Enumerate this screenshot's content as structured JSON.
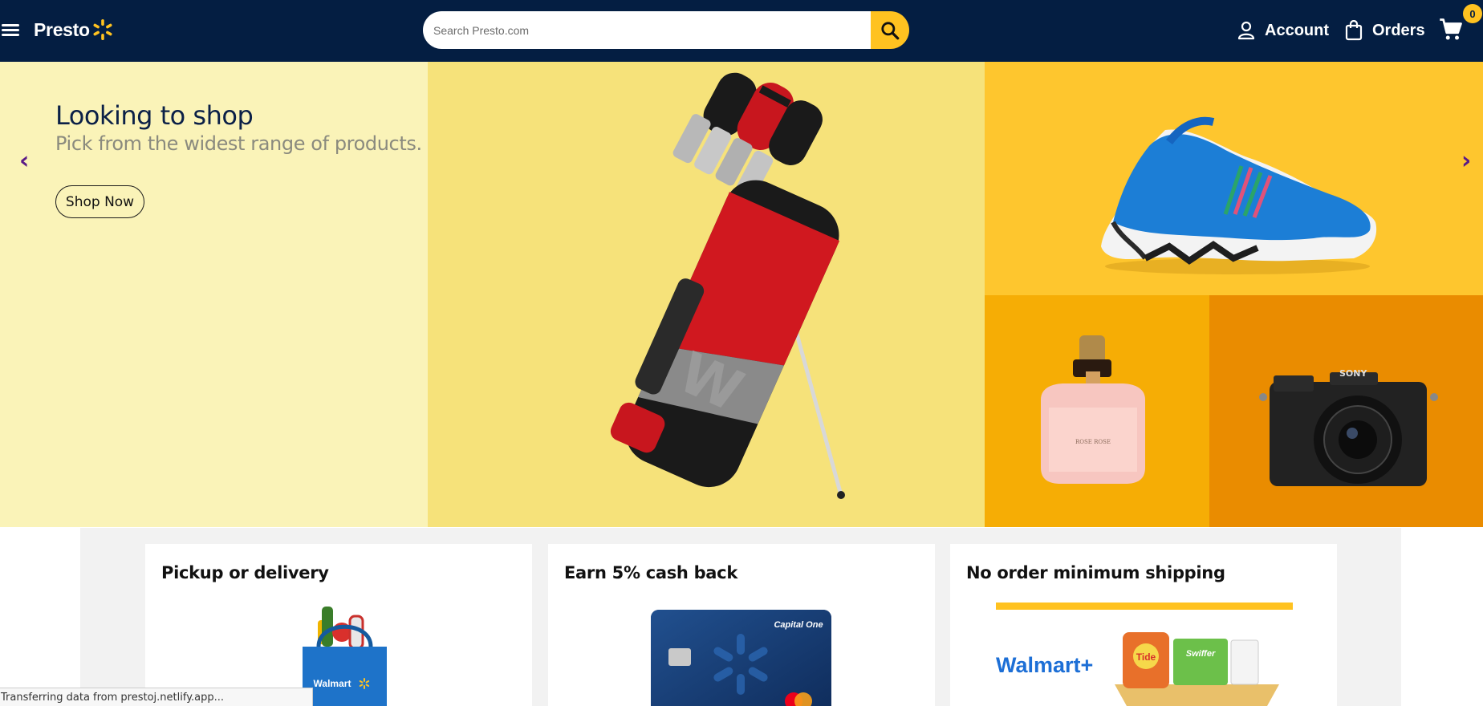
{
  "header": {
    "logo_text": "Presto",
    "search_placeholder": "Search Presto.com",
    "account_label": "Account",
    "orders_label": "Orders",
    "cart_count": "0",
    "colors": {
      "bg": "#041e42",
      "accent": "#ffc220"
    }
  },
  "hero": {
    "title": "Looking to shop",
    "subtitle": "Pick from the widest range of products.",
    "cta_label": "Shop Now",
    "prev_arrow": "‹",
    "next_arrow": "›"
  },
  "cards": [
    {
      "title": "Pickup or delivery"
    },
    {
      "title": "Earn 5% cash back"
    },
    {
      "title": "No order minimum shipping"
    }
  ],
  "status_bar": {
    "text": "Transferring data from prestoj.netlify.app..."
  },
  "images": {
    "golf_bag_brand": "W",
    "perfume_label": "ROSE ROSE",
    "camera_brand": "SONY",
    "bag_brand": "Walmart",
    "card_brand": "Capital One",
    "shipping_brand": "Walmart+",
    "detergent_brand": "Tide",
    "swiffer_brand": "Swiffer"
  }
}
